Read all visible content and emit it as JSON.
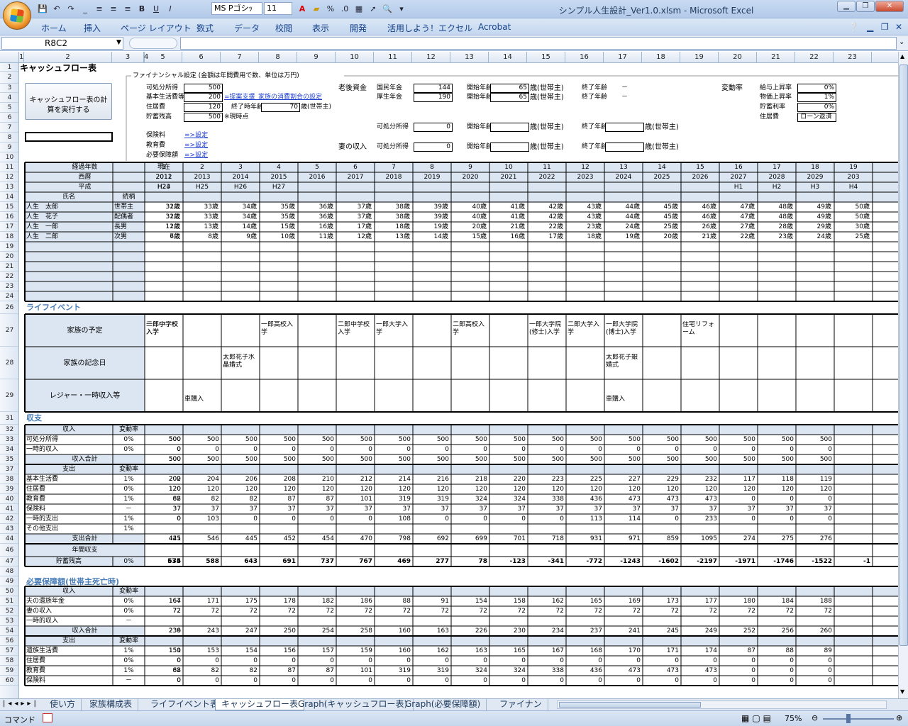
{
  "window": {
    "title": "シンプル人生設計_Ver1.0.xlsm - Microsoft Excel",
    "font_name": "MS Pゴシｯ",
    "font_size": "11"
  },
  "ribbon_tabs": [
    "ホーム",
    "挿入",
    "ページ レイアウト",
    "数式",
    "データ",
    "校閲",
    "表示",
    "開発",
    "活用しよう！エクセル",
    "Acrobat"
  ],
  "name_box": "R8C2",
  "columns": [
    "1",
    "2",
    "3",
    "4",
    "5",
    "6",
    "7",
    "8",
    "9",
    "10",
    "11",
    "12",
    "13",
    "14",
    "15",
    "16",
    "17",
    "18",
    "19",
    "20",
    "21",
    "22",
    "23"
  ],
  "rows": [
    "1",
    "2",
    "3",
    "4",
    "5",
    "6",
    "7",
    "8",
    "9",
    "10",
    "11",
    "12",
    "13",
    "14",
    "15",
    "16",
    "17",
    "18",
    "19",
    "20",
    "21",
    "22",
    "23",
    "24",
    "26",
    "27",
    "28",
    "29",
    "31",
    "32",
    "33",
    "34",
    "35",
    "37",
    "38",
    "39",
    "40",
    "41",
    "42",
    "43",
    "44",
    "46",
    "47",
    "48",
    "49",
    "50",
    "51",
    "52",
    "53",
    "54",
    "56",
    "57",
    "58",
    "59",
    "60"
  ],
  "sheet_title": "キャッシュフロー表",
  "calc_button": "キャッシュフロー表の計算を実行する",
  "settings": {
    "header": "ファイナンシャル設定 (金額は年間費用で数、単位は万円)",
    "left": [
      {
        "label": "可処分所得",
        "value": "500"
      },
      {
        "label": "基本生活費等",
        "value": "200",
        "note": "=提案支援_家族の消費割合の設定"
      },
      {
        "label": "住居費",
        "value": "120",
        "sub_label": "終了時年齢",
        "sub_value": "70",
        "unit": "歳(世帯主)"
      },
      {
        "label": "貯蓄残高",
        "value": "500",
        "note": "※現時点"
      }
    ],
    "links": [
      {
        "label": "保険料",
        "link": "=>設定"
      },
      {
        "label": "教育費",
        "link": "=>設定"
      },
      {
        "label": "必要保障額",
        "link": "=>設定"
      }
    ],
    "pension": {
      "heading": "老後資金",
      "rows": [
        {
          "label": "国民年金",
          "value": "144",
          "start_label": "開始年齢",
          "start": "65",
          "unit": "歳(世帯主)",
          "end_label": "終了年齢",
          "end": "－"
        },
        {
          "label": "厚生年金",
          "value": "190",
          "start_label": "開始年齢",
          "start": "65",
          "unit": "歳(世帯主)",
          "end_label": "終了年齢",
          "end": "－"
        },
        {
          "label": "可処分所得",
          "value": "0",
          "start_label": "開始年齢",
          "start": "",
          "unit": "歳(世帯主)",
          "end_label": "終了年齢",
          "end": "",
          "end_unit": "歳(世帯主)"
        }
      ],
      "wife_heading": "妻の収入",
      "wife": {
        "label": "可処分所得",
        "value": "0",
        "start_label": "開始年齢",
        "unit": "歳(世帯主)",
        "end_label": "終了年齢",
        "end_unit": "歳(世帯主)"
      }
    },
    "rates": {
      "heading": "変動率",
      "rows": [
        {
          "label": "給与上昇率",
          "value": "0%"
        },
        {
          "label": "物価上昇率",
          "value": "1%"
        },
        {
          "label": "貯蓄利率",
          "value": "0%"
        },
        {
          "label": "住居費",
          "value": "ローン返済"
        }
      ]
    }
  },
  "header_rows": {
    "years_label": "経過年数",
    "years": [
      "現在",
      "1",
      "2",
      "3",
      "4",
      "5",
      "6",
      "7",
      "8",
      "9",
      "10",
      "11",
      "12",
      "13",
      "14",
      "15",
      "16",
      "17",
      "18",
      "19"
    ],
    "ad_label": "西暦",
    "ad": [
      "2011",
      "2012",
      "2013",
      "2014",
      "2015",
      "2016",
      "2017",
      "2018",
      "2019",
      "2020",
      "2021",
      "2022",
      "2023",
      "2024",
      "2025",
      "2026",
      "2027",
      "2028",
      "2029",
      "203"
    ],
    "era_label": "平成",
    "era": [
      "H23",
      "H24",
      "H25",
      "H26",
      "H27",
      "",
      "",
      "",
      "",
      "",
      "",
      "",
      "",
      "",
      "",
      "",
      "H1",
      "H2",
      "H3",
      "H4"
    ],
    "name_label": "氏名",
    "rel_label": "続柄"
  },
  "family": [
    {
      "name": "人生　太郎",
      "rel": "世帯主",
      "ages": [
        "31歳",
        "32歳",
        "33歳",
        "34歳",
        "35歳",
        "36歳",
        "37歳",
        "38歳",
        "39歳",
        "40歳",
        "41歳",
        "42歳",
        "43歳",
        "44歳",
        "45歳",
        "46歳",
        "47歳",
        "48歳",
        "49歳",
        "50歳"
      ]
    },
    {
      "name": "人生　花子",
      "rel": "配偶者",
      "ages": [
        "31歳",
        "32歳",
        "33歳",
        "34歳",
        "35歳",
        "36歳",
        "37歳",
        "38歳",
        "39歳",
        "40歳",
        "41歳",
        "42歳",
        "43歳",
        "44歳",
        "45歳",
        "46歳",
        "47歳",
        "48歳",
        "49歳",
        "50歳"
      ]
    },
    {
      "name": "人生　一郎",
      "rel": "長男",
      "ages": [
        "11歳",
        "12歳",
        "13歳",
        "14歳",
        "15歳",
        "16歳",
        "17歳",
        "18歳",
        "19歳",
        "20歳",
        "21歳",
        "22歳",
        "23歳",
        "24歳",
        "25歳",
        "26歳",
        "27歳",
        "28歳",
        "29歳",
        "30歳"
      ]
    },
    {
      "name": "人生　二郎",
      "rel": "次男",
      "ages": [
        "6歳",
        "7歳",
        "8歳",
        "9歳",
        "10歳",
        "11歳",
        "12歳",
        "13歳",
        "14歳",
        "15歳",
        "16歳",
        "17歳",
        "18歳",
        "19歳",
        "20歳",
        "21歳",
        "22歳",
        "23歳",
        "24歳",
        "25歳"
      ]
    }
  ],
  "life_event": {
    "title": "ライフイベント",
    "plan_label": "家族の予定",
    "plan": [
      "二郎小学校入学",
      "一郎中学校入学",
      "",
      "",
      "一郎高校入学",
      "",
      "二郎中学校入学",
      "一郎大学入学",
      "",
      "二郎高校入学",
      "",
      "一郎大学院(修士)入学",
      "二郎大学入学",
      "一郎大学院(博士)入学",
      "",
      "住宅リフォーム",
      "",
      "",
      "",
      ""
    ],
    "anniv_label": "家族の記念日",
    "anniv": [
      "",
      "",
      "",
      "太郎花子水晶婚式",
      "",
      "",
      "",
      "",
      "",
      "",
      "",
      "",
      "",
      "太郎花子銀婚式",
      "",
      "",
      "",
      "",
      "",
      ""
    ],
    "leisure_label": "レジャー・一時収入等",
    "leisure": [
      "",
      "",
      "車購入",
      "",
      "",
      "",
      "",
      "",
      "",
      "",
      "",
      "",
      "",
      "車購入",
      "",
      "",
      "",
      "",
      "",
      ""
    ]
  },
  "income_section": {
    "title": "収支",
    "income_header": "収入",
    "rate_header": "変動率",
    "income": [
      {
        "label": "可処分所得",
        "rate": "0%",
        "values": [
          "500",
          "500",
          "500",
          "500",
          "500",
          "500",
          "500",
          "500",
          "500",
          "500",
          "500",
          "500",
          "500",
          "500",
          "500",
          "500",
          "500",
          "500",
          "500"
        ]
      },
      {
        "label": "一時的収入",
        "rate": "0%",
        "values": [
          "0",
          "0",
          "0",
          "0",
          "0",
          "0",
          "0",
          "0",
          "0",
          "0",
          "0",
          "0",
          "0",
          "0",
          "0",
          "0",
          "0",
          "0",
          "0"
        ]
      }
    ],
    "income_total": {
      "label": "収入合計",
      "values": [
        "500",
        "500",
        "500",
        "500",
        "500",
        "500",
        "500",
        "500",
        "500",
        "500",
        "500",
        "500",
        "500",
        "500",
        "500",
        "500",
        "500",
        "500",
        "500"
      ]
    },
    "expense_header": "支出",
    "expense": [
      {
        "label": "基本生活費",
        "rate": "1%",
        "values": [
          "200",
          "202",
          "204",
          "206",
          "208",
          "210",
          "212",
          "214",
          "216",
          "218",
          "220",
          "223",
          "225",
          "227",
          "229",
          "232",
          "117",
          "118",
          "119"
        ]
      },
      {
        "label": "住居費",
        "rate": "0%",
        "values": [
          "120",
          "120",
          "120",
          "120",
          "120",
          "120",
          "120",
          "120",
          "120",
          "120",
          "120",
          "120",
          "120",
          "120",
          "120",
          "120",
          "120",
          "120",
          "120"
        ]
      },
      {
        "label": "教育費",
        "rate": "1%",
        "values": [
          "68",
          "82",
          "82",
          "82",
          "87",
          "87",
          "101",
          "319",
          "319",
          "324",
          "324",
          "338",
          "436",
          "473",
          "473",
          "473",
          "0",
          "0",
          "0"
        ]
      },
      {
        "label": "保険料",
        "rate": "－",
        "values": [
          "37",
          "37",
          "37",
          "37",
          "37",
          "37",
          "37",
          "37",
          "37",
          "37",
          "37",
          "37",
          "37",
          "37",
          "37",
          "37",
          "37",
          "37",
          "37"
        ]
      },
      {
        "label": "一時的支出",
        "rate": "1%",
        "values": [
          "0",
          "0",
          "103",
          "0",
          "0",
          "0",
          "0",
          "108",
          "0",
          "0",
          "0",
          "0",
          "113",
          "114",
          "0",
          "233",
          "0",
          "0",
          "0"
        ]
      },
      {
        "label": "その他支出",
        "rate": "1%",
        "values": [
          "",
          "",
          "",
          "",
          "",
          "",
          "",
          "",
          "",
          "",
          "",
          "",
          "",
          "",
          "",
          "",
          "",
          "",
          ""
        ]
      }
    ],
    "expense_total": {
      "label": "支出合計",
      "values": [
        "425",
        "441",
        "546",
        "445",
        "452",
        "454",
        "470",
        "798",
        "692",
        "699",
        "701",
        "718",
        "931",
        "971",
        "859",
        "1095",
        "274",
        "275",
        "276"
      ]
    },
    "balance_label": "年間収支",
    "savings": {
      "label": "貯蓄残高",
      "rate": "0%",
      "values": [
        "575",
        "634",
        "588",
        "643",
        "691",
        "737",
        "767",
        "469",
        "277",
        "78",
        "-123",
        "-341",
        "-772",
        "-1243",
        "-1602",
        "-2197",
        "-1971",
        "-1746",
        "-1522",
        "-1"
      ]
    }
  },
  "coverage_section": {
    "title": "必要保障額(世帯主死亡時)",
    "income_header": "収入",
    "rate_header": "変動率",
    "income": [
      {
        "label": "夫の遺族年金",
        "rate": "0%",
        "values": [
          "164",
          "167",
          "171",
          "175",
          "178",
          "182",
          "186",
          "88",
          "91",
          "154",
          "158",
          "162",
          "165",
          "169",
          "173",
          "177",
          "180",
          "184",
          "188"
        ]
      },
      {
        "label": "妻の収入",
        "rate": "0%",
        "values": [
          "72",
          "72",
          "72",
          "72",
          "72",
          "72",
          "72",
          "72",
          "72",
          "72",
          "72",
          "72",
          "72",
          "72",
          "72",
          "72",
          "72",
          "72",
          "72"
        ]
      },
      {
        "label": "一時的収入",
        "rate": "－",
        "values": [
          "",
          "",
          "",
          "",
          "",
          "",
          "",
          "",
          "",
          "",
          "",
          "",
          "",
          "",
          "",
          "",
          "",
          "",
          ""
        ]
      }
    ],
    "income_total": {
      "label": "収入合計",
      "values": [
        "236",
        "239",
        "243",
        "247",
        "250",
        "254",
        "258",
        "160",
        "163",
        "226",
        "230",
        "234",
        "237",
        "241",
        "245",
        "249",
        "252",
        "256",
        "260"
      ]
    },
    "expense_header": "支出",
    "expense": [
      {
        "label": "遺族生活費",
        "rate": "1%",
        "values": [
          "150",
          "151",
          "153",
          "154",
          "156",
          "157",
          "159",
          "160",
          "162",
          "163",
          "165",
          "167",
          "168",
          "170",
          "171",
          "174",
          "87",
          "88",
          "89"
        ]
      },
      {
        "label": "住居費",
        "rate": "0%",
        "values": [
          "0",
          "0",
          "0",
          "0",
          "0",
          "0",
          "0",
          "0",
          "0",
          "0",
          "0",
          "0",
          "0",
          "0",
          "0",
          "0",
          "0",
          "0",
          "0"
        ]
      },
      {
        "label": "教育費",
        "rate": "1%",
        "values": [
          "68",
          "82",
          "82",
          "82",
          "87",
          "87",
          "101",
          "319",
          "319",
          "324",
          "324",
          "338",
          "436",
          "473",
          "473",
          "473",
          "0",
          "0",
          "0"
        ]
      },
      {
        "label": "保険料",
        "rate": "－",
        "values": [
          "0",
          "0",
          "0",
          "0",
          "0",
          "0",
          "0",
          "0",
          "0",
          "0",
          "0",
          "0",
          "0",
          "0",
          "0",
          "0",
          "0",
          "0",
          "0"
        ]
      }
    ]
  },
  "sheet_tabs": [
    "使い方",
    "家族構成表",
    "ライフイベント表",
    "キャッシュフロー表",
    "Graph(キャッシュフロー表)",
    "Graph(必要保障額)",
    "ファイナン"
  ],
  "active_tab": "キャッシュフロー表",
  "status": {
    "mode": "コマンド",
    "zoom": "75%"
  }
}
